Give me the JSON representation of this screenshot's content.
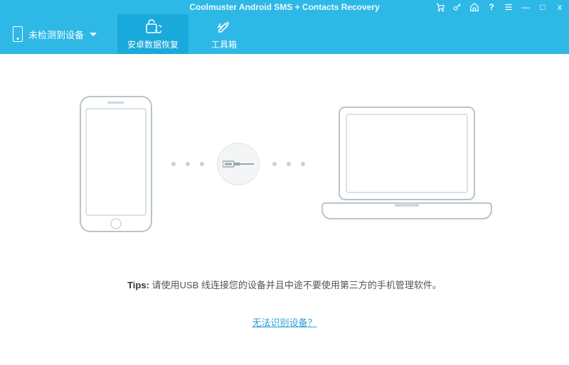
{
  "window": {
    "title": "Coolmuster Android SMS + Contacts Recovery"
  },
  "titlebar_icons": {
    "cart": "cart-icon",
    "key": "key-icon",
    "home": "home-icon",
    "help": "?",
    "menu": "menu-icon",
    "minimize": "—",
    "maximize": "□",
    "close": "x"
  },
  "device": {
    "status_label": "未检测到设备"
  },
  "tabs": {
    "recovery": "安卓数据恢复",
    "toolbox": "工具箱"
  },
  "tips": {
    "label": "Tips:",
    "text": " 请使用USB 线连接您的设备并且中途不要使用第三方的手机管理软件。"
  },
  "help_link": "无法识别设备？"
}
